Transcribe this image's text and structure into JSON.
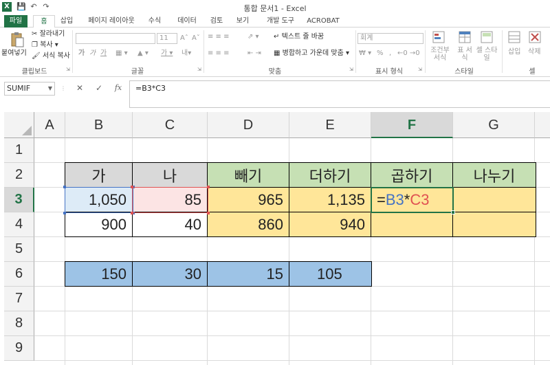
{
  "window": {
    "title": "통합 문서1 - Excel",
    "logo": "X"
  },
  "tabs": [
    "파일",
    "홈",
    "삽입",
    "페이지 레이아웃",
    "수식",
    "데이터",
    "검토",
    "보기",
    "개발 도구",
    "ACROBAT"
  ],
  "ribbon": {
    "clipboard": {
      "paste": "붙여넣기",
      "cut": "잘라내기",
      "copy": "복사",
      "format_painter": "서식 복사",
      "label": "클립보드"
    },
    "font": {
      "size": "11",
      "bold": "가",
      "italic": "가",
      "underline": "가",
      "label": "글꼴"
    },
    "alignment": {
      "wrap_text": "텍스트 줄 바꿈",
      "merge_center": "병합하고 가운데 맞춤",
      "label": "맞춤"
    },
    "number": {
      "format": "회계",
      "percent": "%",
      "comma": ",",
      "label": "표시 형식"
    },
    "styles": {
      "conditional": "조건부 서식",
      "table": "표 서식",
      "cell_styles": "셀 스타일",
      "label": "스타일"
    },
    "cells": {
      "insert": "삽입",
      "delete": "삭제",
      "label": "셀"
    }
  },
  "formula_bar": {
    "name_box": "SUMIF",
    "fx": "fx",
    "formula": "=B3*C3"
  },
  "columns": [
    "A",
    "B",
    "C",
    "D",
    "E",
    "F",
    "G"
  ],
  "rows": [
    "1",
    "2",
    "3",
    "4",
    "5",
    "6",
    "7",
    "8",
    "9"
  ],
  "table": {
    "headers": [
      "가",
      "나",
      "빼기",
      "더하기",
      "곱하기",
      "나누기"
    ],
    "row3": [
      "1,050",
      "85",
      "965",
      "1,135",
      "",
      ""
    ],
    "row4": [
      "900",
      "40",
      "860",
      "940",
      "",
      ""
    ],
    "row6": [
      "150",
      "30",
      "15",
      "105"
    ],
    "edit_formula": {
      "eq": "=",
      "ref1": "B3",
      "op": "*",
      "ref2": "C3"
    }
  },
  "colors": {
    "excel_green": "#217346",
    "header_gray": "#d9d9d9",
    "header_green": "#c6e0b4",
    "data_yellow": "#ffe699",
    "row6_blue": "#9dc3e6",
    "ref_blue": "#4472c4",
    "ref_red": "#e05252"
  }
}
